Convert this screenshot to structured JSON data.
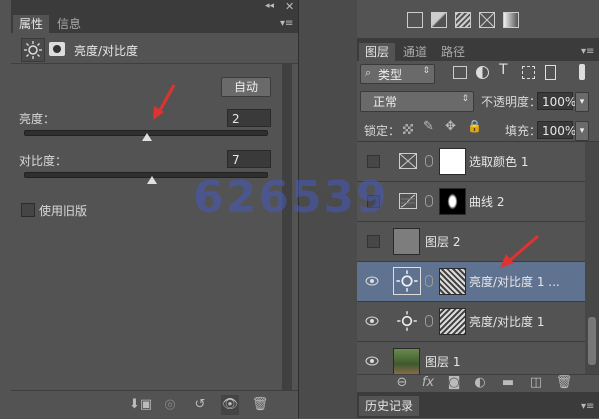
{
  "properties_panel": {
    "tabs": [
      "属性",
      "信息"
    ],
    "title": "亮度/对比度",
    "auto_button": "自动",
    "brightness_label": "亮度：",
    "brightness_value": "2",
    "brightness_slider_fraction": 0.51,
    "contrast_label": "对比度：",
    "contrast_value": "7",
    "contrast_slider_fraction": 0.53,
    "legacy_label": "使用旧版",
    "legacy_checked": false
  },
  "watermark": "626539",
  "layers_panel": {
    "tabs": [
      "图层",
      "通道",
      "路径"
    ],
    "filter_kind": "类型",
    "blend_mode": "正常",
    "opacity_label": "不透明度：",
    "opacity_value": "100%",
    "lock_label": "锁定：",
    "fill_label": "填充：",
    "fill_value": "100%",
    "layers": [
      {
        "name": "选取颜色 1",
        "visible": false,
        "type": "adjustment",
        "icon": "selective-color-icon"
      },
      {
        "name": "曲线 2",
        "visible": false,
        "type": "adjustment",
        "icon": "curves-icon"
      },
      {
        "name": "图层 2",
        "visible": false,
        "type": "pixel"
      },
      {
        "name": "亮度/对比度 1 ...",
        "visible": true,
        "type": "adjustment",
        "icon": "brightness-contrast-icon",
        "selected": true
      },
      {
        "name": "亮度/对比度 1",
        "visible": true,
        "type": "adjustment",
        "icon": "brightness-contrast-icon"
      },
      {
        "name": "图层 1",
        "visible": true,
        "type": "pixel"
      }
    ]
  },
  "history_panel": {
    "tab": "历史记录"
  },
  "colors": {
    "panel_bg": "#535353",
    "selected_row": "#5f7390",
    "accent_arrow": "#e0322f"
  }
}
